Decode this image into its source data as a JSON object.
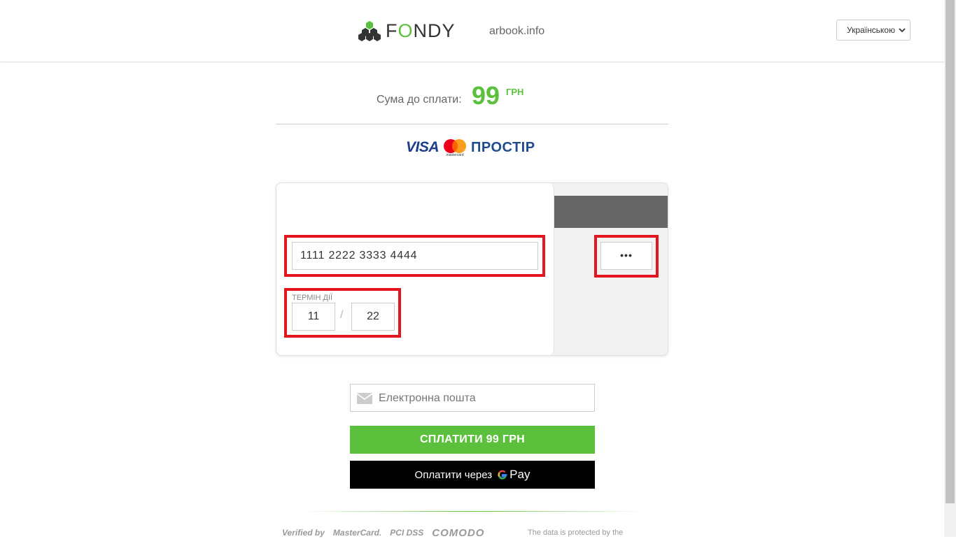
{
  "header": {
    "brand": {
      "before": "F",
      "accent": "O",
      "after": "NDY"
    },
    "merchant": "arbook.info",
    "language": "Українською"
  },
  "amount": {
    "label": "Сума до сплати:",
    "value": "99",
    "currency": "ГРН"
  },
  "brands": {
    "visa": "VISA",
    "mastercard_small": "mastercard",
    "prostir": "ПРОСТІР"
  },
  "card": {
    "number": "1111 2222 3333 4444",
    "expiry_label": "ТЕРМІН ДІЇ",
    "exp_month": "11",
    "exp_separator": "/",
    "exp_year": "22",
    "cvv": "•••"
  },
  "email": {
    "placeholder": "Електронна пошта"
  },
  "buttons": {
    "pay": "СПЛАТИТИ  99  ГРН",
    "gpay_prefix": "Оплатити через",
    "gpay_pay": "Pay"
  },
  "footer": {
    "logos": [
      "Verified by",
      "MasterCard.",
      "PCI DSS",
      "COMODO"
    ],
    "text": "The data is protected by the"
  },
  "colors": {
    "accent_green": "#5bc13c",
    "highlight_red": "#e3151f",
    "visa_blue": "#1a3e8c"
  },
  "icons": [
    "fondy-logo-icon",
    "chevron-down-icon",
    "mastercard-icon",
    "mail-icon",
    "google-g-icon"
  ]
}
